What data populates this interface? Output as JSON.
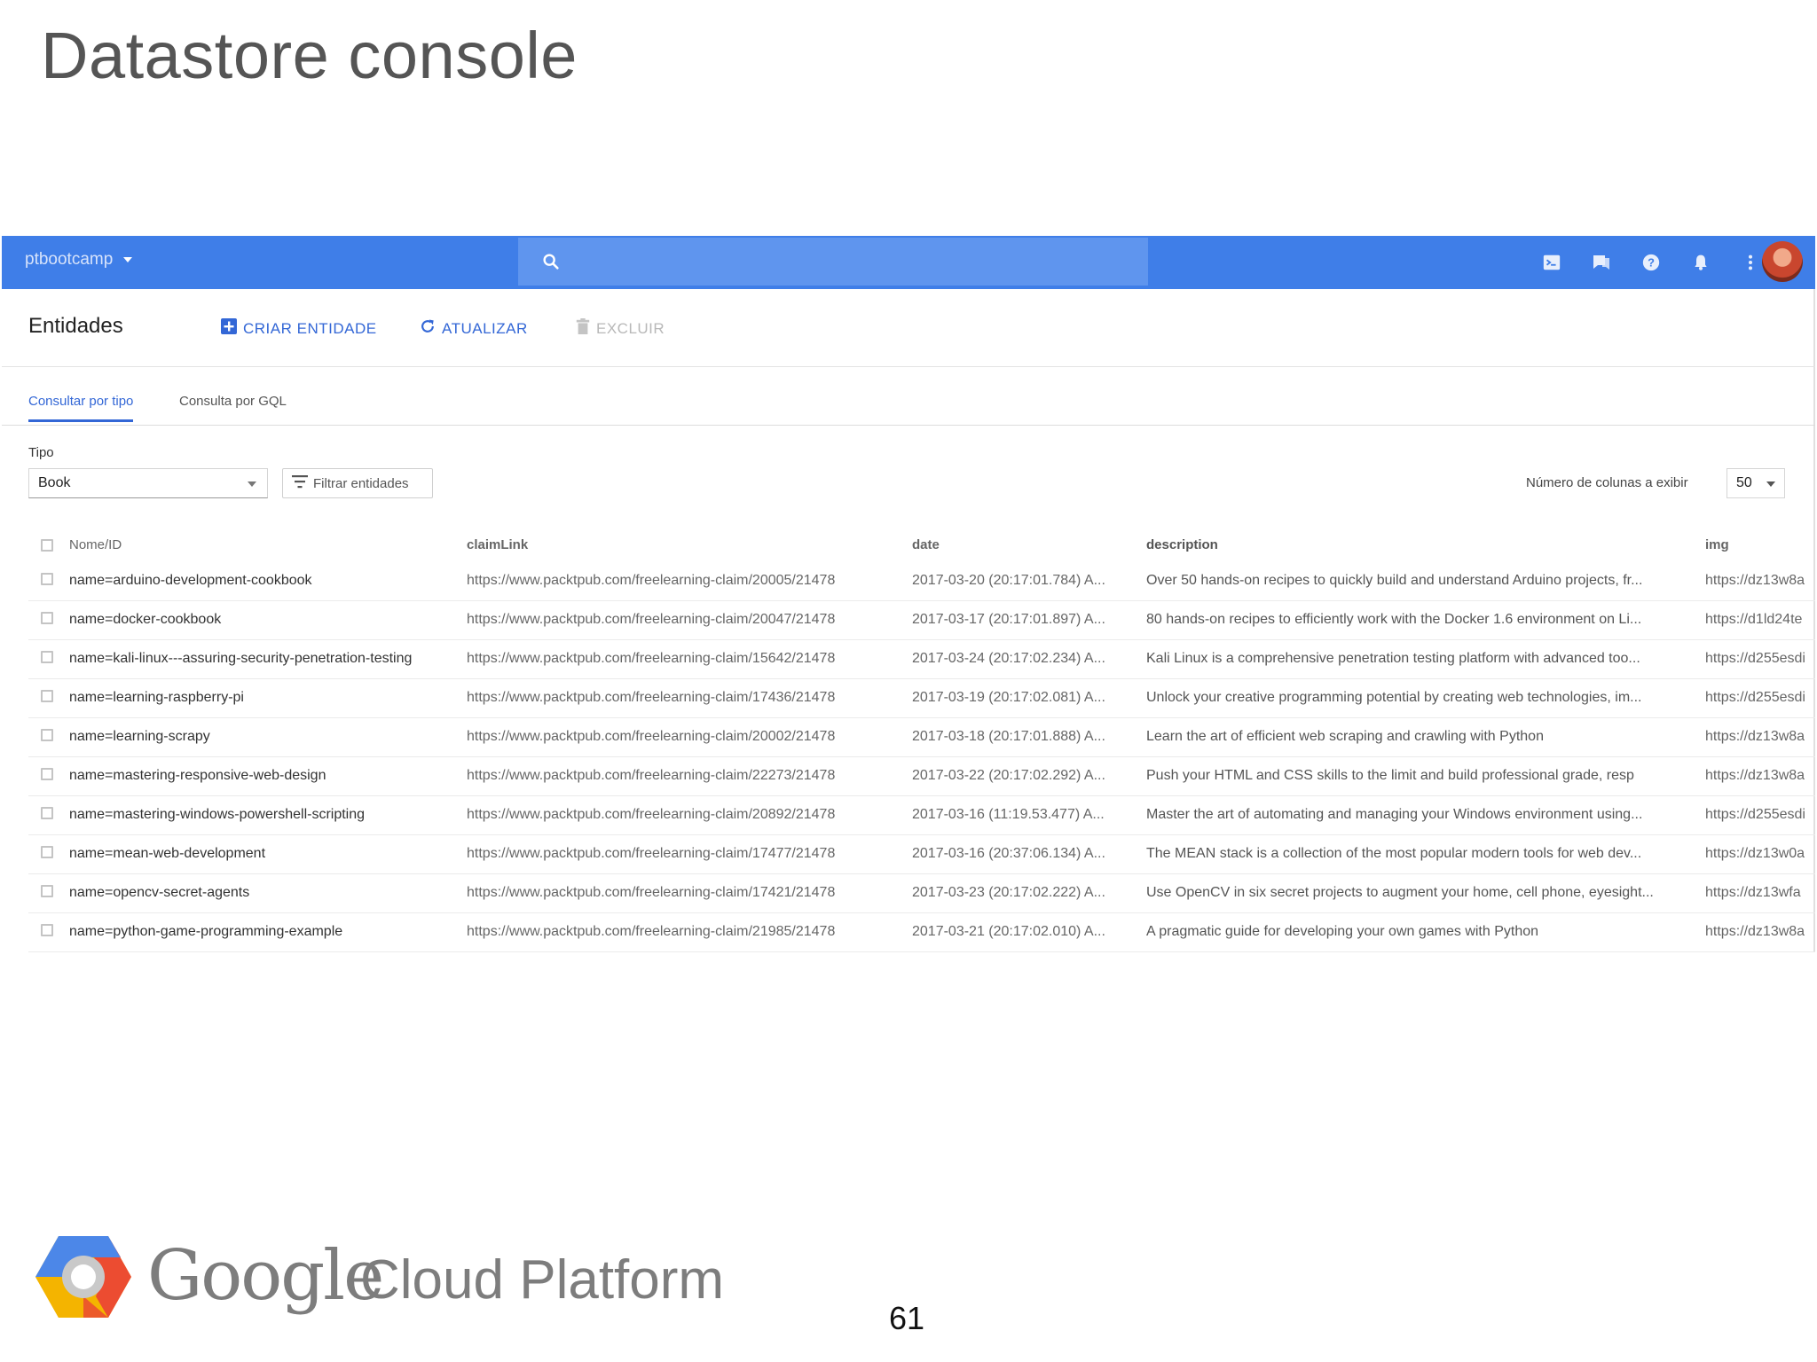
{
  "slide": {
    "title": "Datastore console",
    "page_number": "61",
    "footer_logo_google": "Google",
    "footer_logo_product": "Cloud Platform"
  },
  "topbar": {
    "project": "ptbootcamp",
    "search_placeholder": "",
    "icons": [
      "cloud-shell-icon",
      "notifications-feedback-icon",
      "help-icon",
      "bell-icon",
      "more-vert-icon"
    ],
    "accent_color": "#3f7ee8"
  },
  "toolbar": {
    "title": "Entidades",
    "create_label": "CRIAR ENTIDADE",
    "refresh_label": "ATUALIZAR",
    "delete_label": "EXCLUIR"
  },
  "tabs": [
    {
      "label": "Consultar por tipo",
      "active": true
    },
    {
      "label": "Consulta por GQL",
      "active": false
    }
  ],
  "filters": {
    "type_label": "Tipo",
    "type_value": "Book",
    "filter_button": "Filtrar entidades",
    "columns_label": "Número de colunas a exibir",
    "columns_value": "50"
  },
  "table": {
    "columns": [
      "Nome/ID",
      "claimLink",
      "date",
      "description",
      "img"
    ],
    "rows": [
      [
        "name=arduino-development-cookbook",
        "https://www.packtpub.com/freelearning-claim/20005/21478",
        "2017-03-20 (20:17:01.784) A...",
        "Over 50 hands-on recipes to quickly build and understand Arduino projects, fr...",
        "https://dz13w8a"
      ],
      [
        "name=docker-cookbook",
        "https://www.packtpub.com/freelearning-claim/20047/21478",
        "2017-03-17 (20:17:01.897) A...",
        "80 hands-on recipes to efficiently work with the Docker 1.6 environment on Li...",
        "https://d1ld24te"
      ],
      [
        "name=kali-linux---assuring-security-penetration-testing",
        "https://www.packtpub.com/freelearning-claim/15642/21478",
        "2017-03-24 (20:17:02.234) A...",
        "Kali Linux is a comprehensive penetration testing platform with advanced too...",
        "https://d255esdi"
      ],
      [
        "name=learning-raspberry-pi",
        "https://www.packtpub.com/freelearning-claim/17436/21478",
        "2017-03-19 (20:17:02.081) A...",
        "Unlock your creative programming potential by creating web technologies, im...",
        "https://d255esdi"
      ],
      [
        "name=learning-scrapy",
        "https://www.packtpub.com/freelearning-claim/20002/21478",
        "2017-03-18 (20:17:01.888) A...",
        "Learn the art of efficient web scraping and crawling with Python",
        "https://dz13w8a"
      ],
      [
        "name=mastering-responsive-web-design",
        "https://www.packtpub.com/freelearning-claim/22273/21478",
        "2017-03-22 (20:17:02.292) A...",
        "Push your HTML and CSS skills to the limit and build professional grade, resp",
        "https://dz13w8a"
      ],
      [
        "name=mastering-windows-powershell-scripting",
        "https://www.packtpub.com/freelearning-claim/20892/21478",
        "2017-03-16 (11:19.53.477) A...",
        "Master the art of automating and managing your Windows environment using...",
        "https://d255esdi"
      ],
      [
        "name=mean-web-development",
        "https://www.packtpub.com/freelearning-claim/17477/21478",
        "2017-03-16 (20:37:06.134) A...",
        "The MEAN stack is a collection of the most popular modern tools for web dev...",
        "https://dz13w0a"
      ],
      [
        "name=opencv-secret-agents",
        "https://www.packtpub.com/freelearning-claim/17421/21478",
        "2017-03-23 (20:17:02.222) A...",
        "Use OpenCV in six secret projects to augment your home, cell phone, eyesight...",
        "https://dz13wfa"
      ],
      [
        "name=python-game-programming-example",
        "https://www.packtpub.com/freelearning-claim/21985/21478",
        "2017-03-21 (20:17:02.010) A...",
        "A pragmatic guide for developing your own games with Python",
        "https://dz13w8a"
      ]
    ]
  }
}
